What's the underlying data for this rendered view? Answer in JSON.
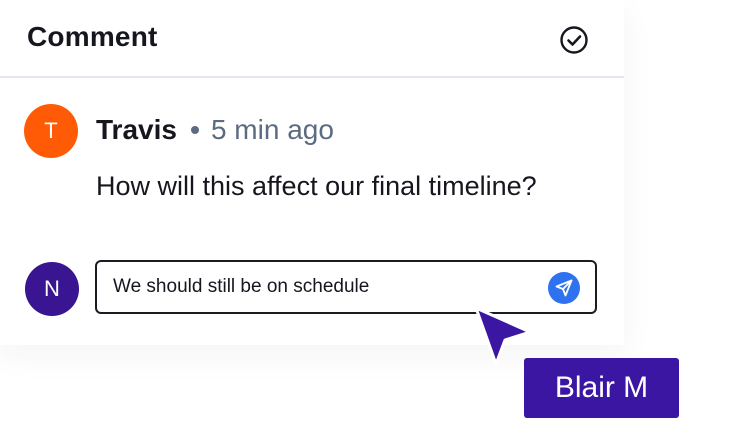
{
  "header": {
    "title": "Comment",
    "resolve_icon": "check-circle-icon"
  },
  "comment": {
    "avatar_initial": "T",
    "avatar_color": "#ff5b06",
    "author": "Travis",
    "separator_icon": "dot-icon",
    "time": "5 min ago",
    "text": "How will this affect our final timeline?"
  },
  "reply": {
    "avatar_initial": "N",
    "avatar_color": "#3a1591",
    "value": "We should still be on schedule",
    "send_icon": "send-icon",
    "send_color": "#2f72f0"
  },
  "collaborator_cursor": {
    "icon": "pointer-cursor-icon",
    "name": "Blair M",
    "color": "#3b16a3"
  }
}
